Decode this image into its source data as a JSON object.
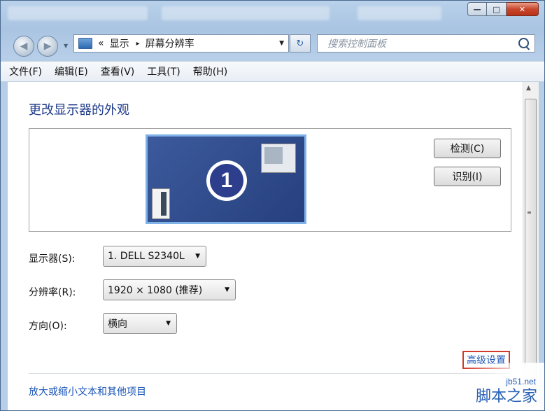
{
  "window": {
    "title_controls": {
      "minimize": "—",
      "maximize": "□",
      "close": "✕"
    }
  },
  "navigation": {
    "address_icon": "monitor-icon",
    "breadcrumb_prefix": "«",
    "breadcrumb": [
      "显示",
      "屏幕分辨率"
    ],
    "breadcrumb_separator": "▸",
    "refresh_symbol": "↻",
    "search_placeholder": "搜索控制面板"
  },
  "menu": [
    "文件(F)",
    "编辑(E)",
    "查看(V)",
    "工具(T)",
    "帮助(H)"
  ],
  "main": {
    "heading": "更改显示器的外观",
    "monitor_badge": "1",
    "detect_button": "检测(C)",
    "identify_button": "识别(I)",
    "display": {
      "label": "显示器(S):",
      "value": "1. DELL S2340L"
    },
    "resolution": {
      "label": "分辨率(R):",
      "value": "1920 × 1080 (推荐)"
    },
    "orientation": {
      "label": "方向(O):",
      "value": "横向"
    },
    "advanced_link": "高级设置",
    "bottom_link": "放大或缩小文本和其他项目"
  },
  "watermark": {
    "url": "jb51.net",
    "name": "脚本之家"
  },
  "colors": {
    "accent": "#1a55b8",
    "heading": "#1e3a8a",
    "highlight_border": "#d13a2a",
    "monitor_tile": "#3c5a9c"
  }
}
